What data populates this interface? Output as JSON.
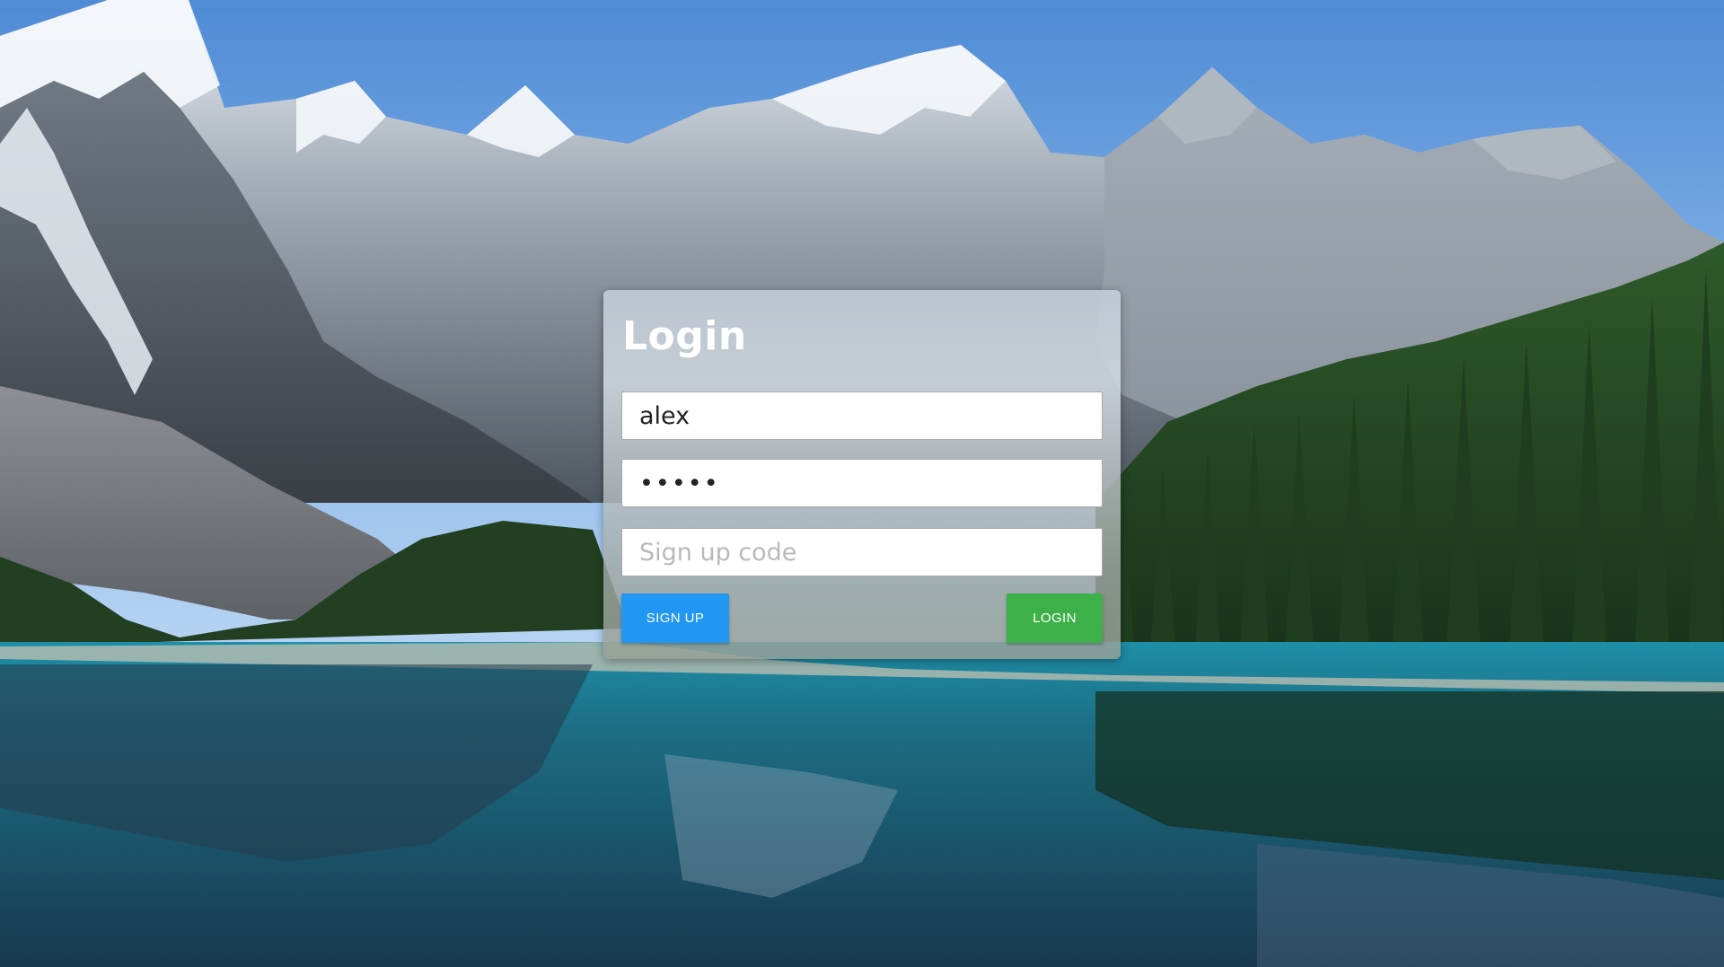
{
  "login": {
    "title": "Login",
    "username_value": "alex",
    "password_value": "•••••",
    "signup_code_placeholder": "Sign up code",
    "signup_button_label": "SIGN UP",
    "login_button_label": "LOGIN"
  },
  "colors": {
    "signup_button": "#2196f3",
    "login_button": "#3eb049"
  }
}
